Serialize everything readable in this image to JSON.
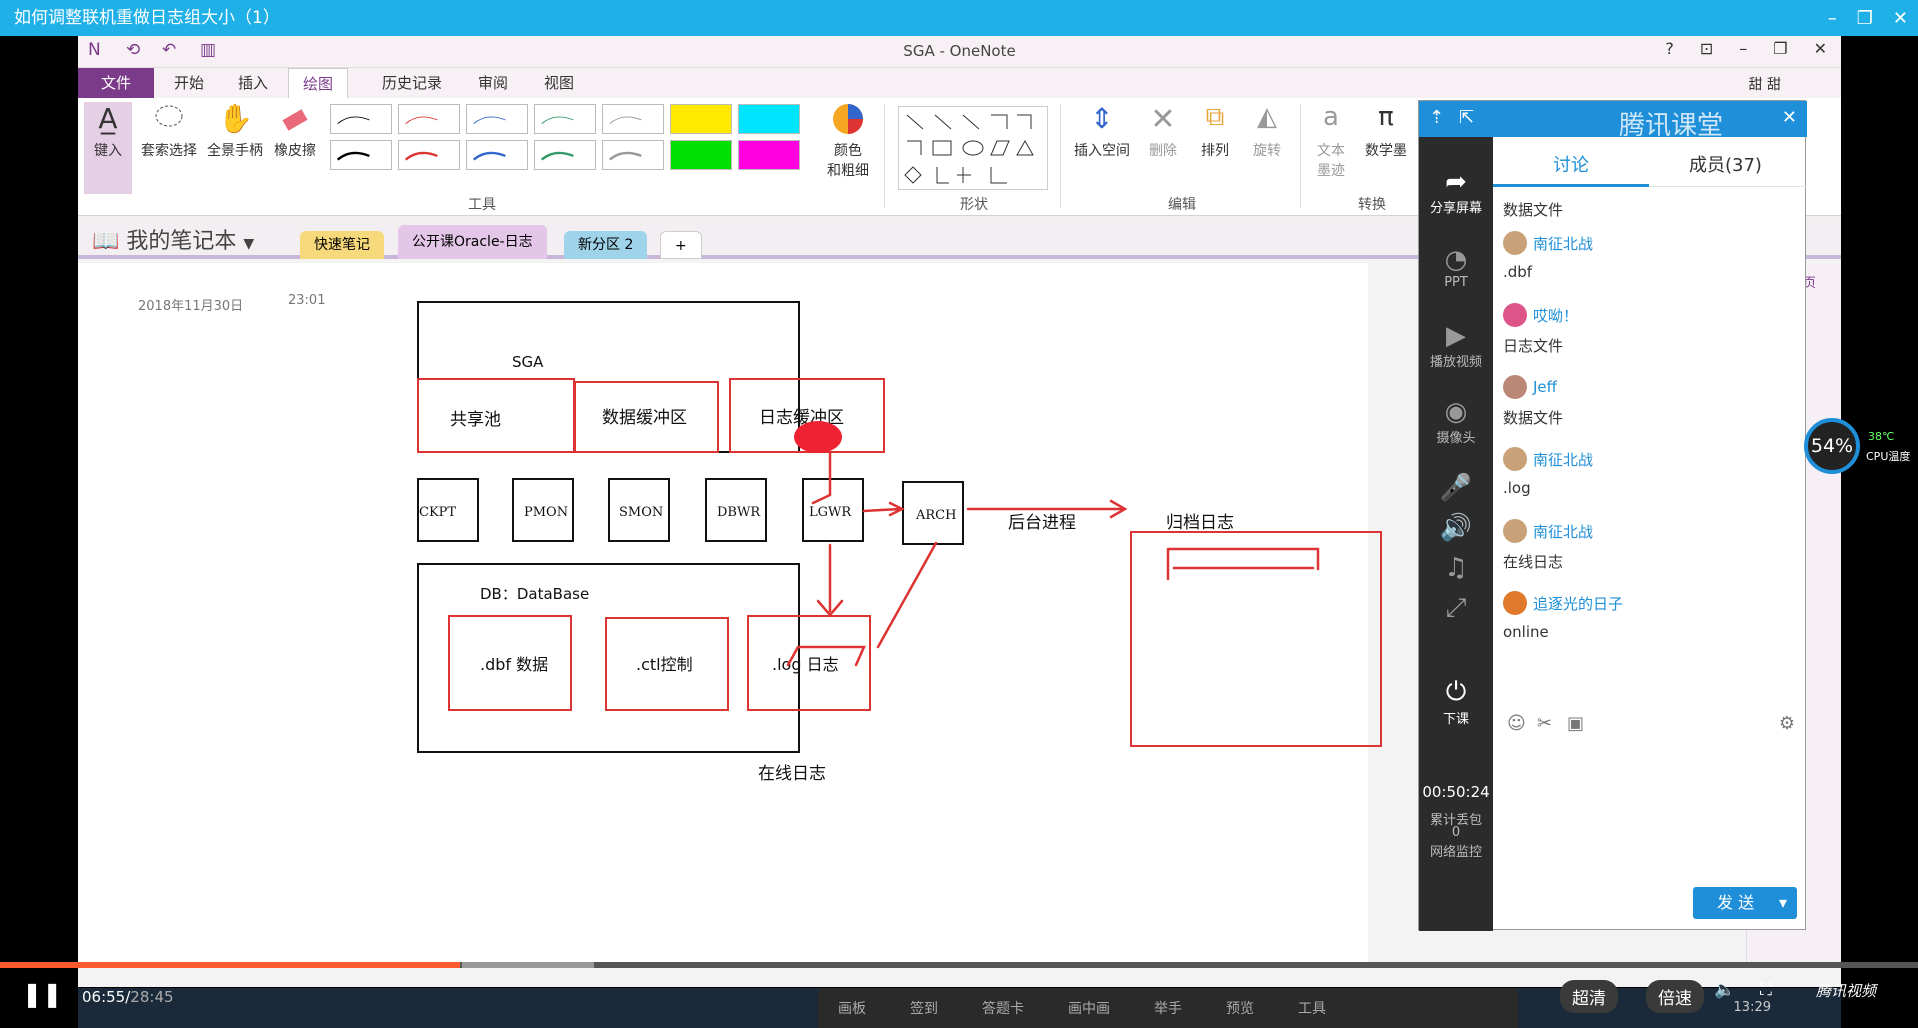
{
  "player": {
    "title": "如何调整联机重做日志组大小（1）",
    "current_time": "06:55",
    "total_time": "28:45",
    "progress": 0.24,
    "quality_label": "超清",
    "speed_label": "倍速",
    "brand": "腾讯视频"
  },
  "onenote": {
    "window_title": "SGA - OneNote",
    "user": "甜 甜",
    "tabs": [
      "文件",
      "开始",
      "插入",
      "绘图",
      "历史记录",
      "审阅",
      "视图"
    ],
    "active_tab": "绘图",
    "ribbon": {
      "type_label": "键入",
      "lasso_label": "套索选择",
      "pan_label": "全景手柄",
      "eraser_label": "橡皮擦",
      "color_label": "颜色\n和粗细",
      "tools_group": "工具",
      "shapes_group": "形状",
      "insert_space_label": "插入空间",
      "delete_label": "删除",
      "arrange_label": "排列",
      "rotate_label": "旋转",
      "edit_group": "编辑",
      "ink_to_text_label": "文本\n墨迹",
      "math_label": "数学墨",
      "convert_group": "转换"
    },
    "notebook_name": "我的笔记本",
    "sections": [
      "快速笔记",
      "公开课Oracle-日志",
      "新分区 2",
      "+"
    ],
    "right_strip_label": "添加页",
    "page": {
      "date": "2018年11月30日",
      "time": "23:01",
      "sga_label": "SGA",
      "shared_pool": "共享池",
      "db_buffer": "数据缓冲区",
      "log_buffer": "日志缓冲区",
      "processes": [
        "CKPT",
        "PMON",
        "SMON",
        "DBWR",
        "LGWR",
        "ARCH"
      ],
      "bg_process_label": "后台进程",
      "archive_log_label": "归档日志",
      "db_label": "DB：DataBase",
      "dbf_label": ".dbf 数据",
      "ctl_label": ".ctl控制",
      "log_label": ".log 日志",
      "online_log_label": "在线日志"
    }
  },
  "tencent_class": {
    "brand": "腾讯课堂",
    "side_items": [
      "分享屏幕",
      "PPT",
      "播放视频",
      "摄像头",
      "下课"
    ],
    "timer": "00:50:24",
    "packet_loss_label": "累计丢包",
    "packet_loss_value": "0",
    "network_label": "网络监控",
    "tabs": [
      "讨论",
      "成员(37)"
    ],
    "messages": [
      {
        "user": "",
        "text": "数据文件"
      },
      {
        "user": "南征北战",
        "text": ".dbf"
      },
      {
        "user": "哎呦！",
        "text": "日志文件"
      },
      {
        "user": "Jeff",
        "text": "数据文件"
      },
      {
        "user": "南征北战",
        "text": ".log"
      },
      {
        "user": "南征北战",
        "text": "在线日志"
      },
      {
        "user": "追逐光的日子",
        "text": "online"
      }
    ],
    "send_label": "发 送"
  },
  "system": {
    "cpu_percent": "54%",
    "cpu_temp": "38℃",
    "cpu_temp_label": "CPU温度",
    "clock": "13:29",
    "taskbar_labels": [
      "画板",
      "签到",
      "答题卡",
      "画中画",
      "举手",
      "预览",
      "工具"
    ]
  },
  "colors": {
    "player_bar": "#1fb0e8",
    "onenote_purple": "#7c3a8a",
    "tencent_blue": "#1e8fd8",
    "ink_red": "#d33333",
    "progress_orange": "#ff5a2d"
  }
}
